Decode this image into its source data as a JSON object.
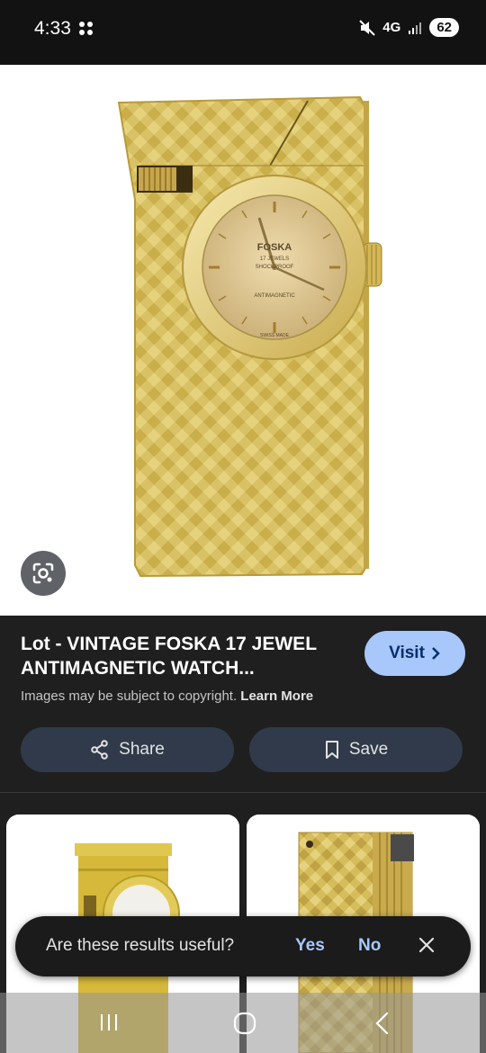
{
  "status_bar": {
    "time": "4:33",
    "network": "4G",
    "battery": "62"
  },
  "result": {
    "title": "Lot - VINTAGE FOSKA 17 JEWEL ANTIMAGNETIC WATCH...",
    "visit_label": "Visit",
    "copyright_text": "Images may be subject to copyright.",
    "learn_more": "Learn More",
    "share_label": "Share",
    "save_label": "Save"
  },
  "watch_face": {
    "brand": "FOSKA",
    "line1": "17 JEWELS",
    "line2": "SHOCKPROOF",
    "line3": "ANTIMAGNETIC",
    "line4": "SWISS MADE"
  },
  "snackbar": {
    "question": "Are these results useful?",
    "yes": "Yes",
    "no": "No"
  },
  "colors": {
    "accent": "#a8c7fa",
    "button_bg": "#303a4a",
    "gold": "#d6bd5c"
  },
  "icons": [
    "google-lens-icon",
    "chevron-right-icon",
    "share-icon",
    "bookmark-icon",
    "close-icon",
    "recents-icon",
    "home-icon",
    "back-icon"
  ]
}
